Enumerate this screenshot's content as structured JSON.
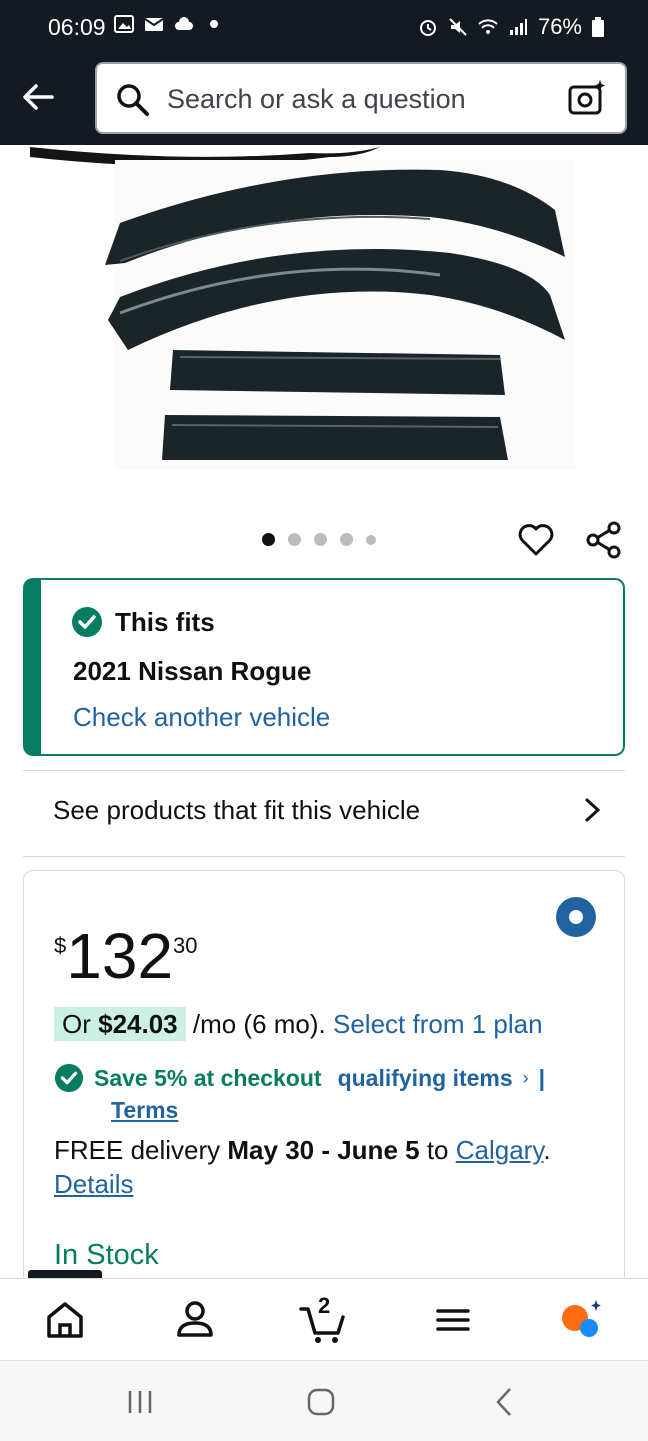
{
  "status_bar": {
    "time": "06:09",
    "battery": "76%"
  },
  "header": {
    "search_placeholder": "Search or ask a question"
  },
  "gallery": {
    "image_count": 5,
    "active_index": 0
  },
  "fitment": {
    "title": "This fits",
    "vehicle": "2021 Nissan Rogue",
    "link": "Check another vehicle"
  },
  "see_products": "See products that fit this vehicle",
  "price": {
    "currency": "$",
    "whole": "132",
    "fraction": "30",
    "monthly_prefix": "Or ",
    "monthly_amount": "$24.03",
    "monthly_suffix": " /mo (6 mo). ",
    "monthly_link": "Select from 1 plan",
    "save_text": "Save 5% at checkout",
    "qualifying": "qualifying items",
    "terms": "Terms",
    "delivery_prefix": "FREE delivery ",
    "delivery_dates": "May 30 - June 5",
    "delivery_to": " to ",
    "delivery_city": "Calgary",
    "details": "Details",
    "stock": "In Stock"
  },
  "bottom_nav": {
    "cart_count": "2"
  },
  "colors": {
    "header_bg": "#131a22",
    "accent_green": "#067d62",
    "link_blue": "#2162a1"
  }
}
